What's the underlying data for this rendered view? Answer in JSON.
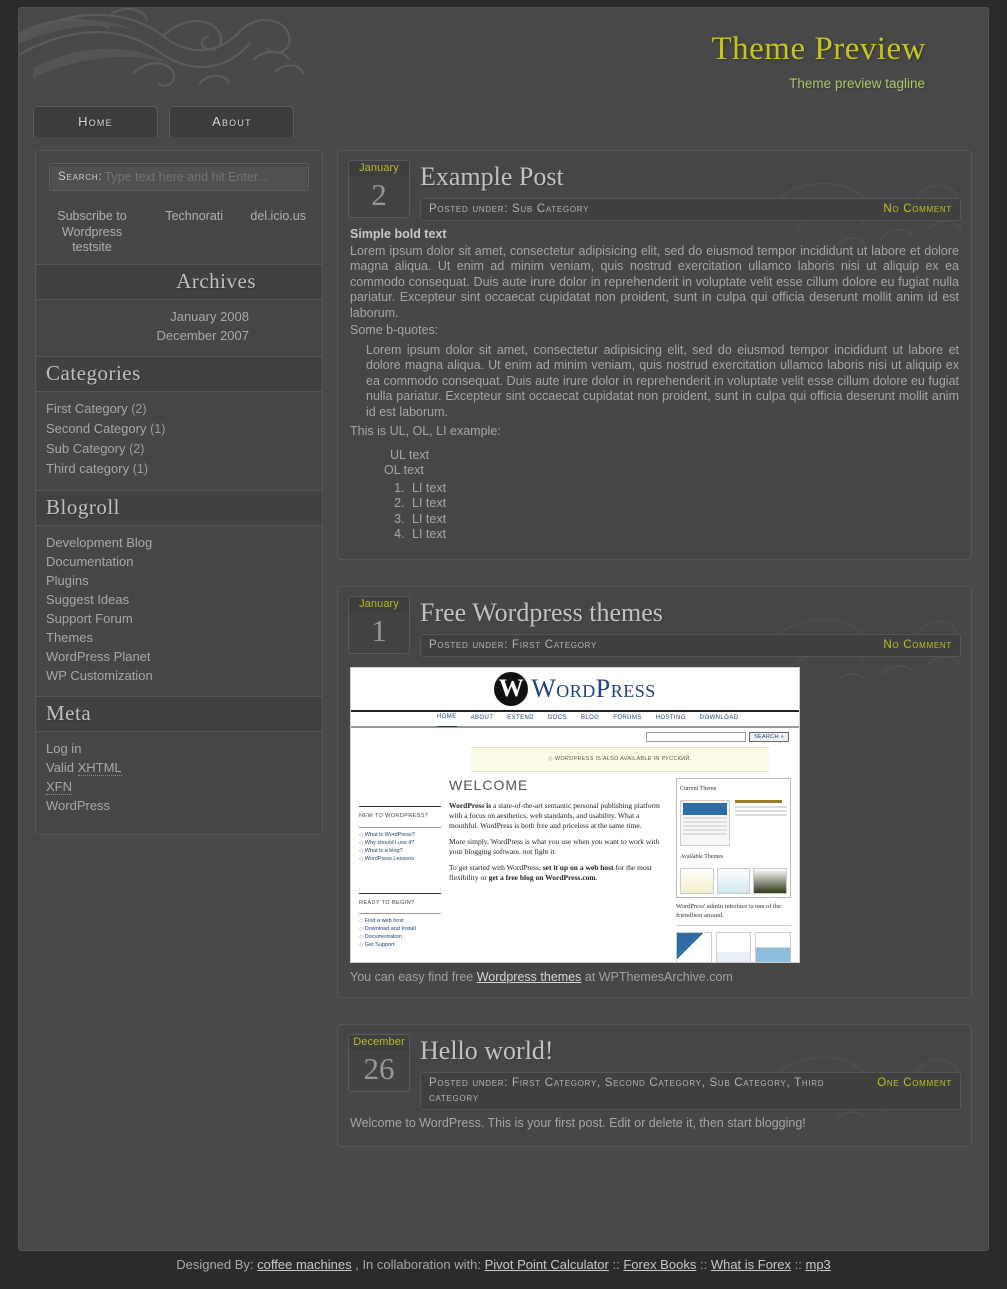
{
  "site": {
    "title": "Theme Preview",
    "tagline": "Theme preview tagline"
  },
  "nav": {
    "tabs": [
      {
        "label": "Home"
      },
      {
        "label": "About"
      }
    ]
  },
  "sidebar": {
    "search": {
      "label": "Search:",
      "placeholder": "Type text here and hit Enter...",
      "value": ""
    },
    "social": [
      {
        "label": "Subscribe to Wordpress testsite"
      },
      {
        "label": "Technorati"
      },
      {
        "label": "del.icio.us"
      }
    ],
    "archives": {
      "heading": "Archives",
      "items": [
        {
          "label": "January 2008"
        },
        {
          "label": "December 2007"
        }
      ]
    },
    "categories": {
      "heading": "Categories",
      "items": [
        {
          "label": "First Category",
          "count": "(2)"
        },
        {
          "label": "Second Category",
          "count": "(1)"
        },
        {
          "label": "Sub Category",
          "count": "(2)"
        },
        {
          "label": "Third category",
          "count": "(1)"
        }
      ]
    },
    "blogroll": {
      "heading": "Blogroll",
      "items": [
        {
          "label": "Development Blog"
        },
        {
          "label": "Documentation"
        },
        {
          "label": "Plugins"
        },
        {
          "label": "Suggest Ideas"
        },
        {
          "label": "Support Forum"
        },
        {
          "label": "Themes"
        },
        {
          "label": "WordPress Planet"
        },
        {
          "label": "WP Customization"
        }
      ]
    },
    "meta": {
      "heading": "Meta",
      "items": [
        {
          "label": "Log in"
        },
        {
          "label": "Valid ",
          "abbr": "XHTML"
        },
        {
          "label": "",
          "abbr": "XFN"
        },
        {
          "label": "WordPress"
        }
      ]
    }
  },
  "posts": {
    "post1": {
      "month": "January",
      "day": "2",
      "title": "Example Post",
      "posted_under": "Posted under: Sub Category",
      "comments": "No Comment",
      "bold_lead": "Simple bold text",
      "paragraph1": "Lorem ipsum dolor sit amet, consectetur adipisicing elit, sed do eiusmod tempor incididunt ut labore et dolore magna aliqua. Ut enim ad minim veniam, quis nostrud exercitation ullamco laboris nisi ut aliquip ex ea commodo consequat. Duis aute irure dolor in reprehenderit in voluptate velit esse cillum dolore eu fugiat nulla pariatur. Excepteur sint occaecat cupidatat non proident, sunt in culpa qui officia deserunt mollit anim id est laborum.",
      "bquote_intro": "Some b-quotes:",
      "blockquote": "Lorem ipsum dolor sit amet, consectetur adipisicing elit, sed do eiusmod tempor incididunt ut labore et dolore magna aliqua. Ut enim ad minim veniam, quis nostrud exercitation ullamco laboris nisi ut aliquip ex ea commodo consequat. Duis aute irure dolor in reprehenderit in voluptate velit esse cillum dolore eu fugiat nulla pariatur. Excepteur sint occaecat cupidatat non proident, sunt in culpa qui officia deserunt mollit anim id est laborum.",
      "list_intro": "This is UL, OL, LI example:",
      "ul_item": "UL text",
      "ol_label": "OL text",
      "ol_items": [
        {
          "label": "LI text"
        },
        {
          "label": "LI text"
        },
        {
          "label": "LI text"
        },
        {
          "label": "LI text"
        }
      ]
    },
    "post2": {
      "month": "January",
      "day": "1",
      "title": "Free Wordpress themes",
      "posted_under": "Posted under: First Category",
      "comments": "No Comment",
      "caption_before": "You can easy find free ",
      "caption_link": "Wordpress themes",
      "caption_after": " at WPThemesArchive.com"
    },
    "post3": {
      "month": "December",
      "day": "26",
      "title": "Hello world!",
      "posted_under": "Posted under: First Category, Second Category, Sub Category, Third category",
      "comments": "One Comment",
      "body": "Welcome to WordPress. This is your first post. Edit or delete it, then start blogging!"
    }
  },
  "wp_screenshot": {
    "logo_mark": "W",
    "logo_text": "WordPress",
    "nav": [
      {
        "label": "HOME"
      },
      {
        "label": "ABOUT"
      },
      {
        "label": "EXTEND"
      },
      {
        "label": "DOCS"
      },
      {
        "label": "BLOG"
      },
      {
        "label": "FORUMS"
      },
      {
        "label": "HOSTING"
      },
      {
        "label": "DOWNLOAD"
      }
    ],
    "search_button": "SEARCH »",
    "notice": "◇ WORDPRESS IS ALSO AVAILABLE IN РУССКИЙ.",
    "welcome": "WELCOME",
    "new_head": "NEW TO WORDPRESS?",
    "new_links": [
      {
        "label": "What is WordPress?"
      },
      {
        "label": "Why should I use it?"
      },
      {
        "label": "What is a blog?"
      },
      {
        "label": "WordPress Lessons"
      }
    ],
    "ready_head": "READY TO BEGIN?",
    "ready_links": [
      {
        "label": "Find a web host"
      },
      {
        "label": "Download and Install"
      },
      {
        "label": "Documentation"
      },
      {
        "label": "Get Support"
      }
    ],
    "para1_bold": "WordPress is",
    "para1": " a state-of-the-art semantic personal publishing platform with a focus on aesthetics, web standards, and usability. What a mouthful. WordPress is both free and priceless at the same time.",
    "para2": "More simply, WordPress is what you use when you want to work with your blogging software, not fight it.",
    "para3_a": "To get started with WordPress, ",
    "para3_b": "set it up on a web host",
    "para3_c": " for the most flexibility or ",
    "para3_d": "get a free blog on WordPress.com",
    "para3_e": ".",
    "current_theme_label": "Current Theme",
    "available_themes_label": "Available Themes",
    "admin_caption": "WordPress' admin interface is one of the friendliest around."
  },
  "footer": {
    "designed_by": "Designed By:",
    "link1": "coffee machines",
    "collab": ", In collaboration with:",
    "link2": "Pivot Point Calculator",
    "sep1": "::",
    "link3": "Forex Books",
    "sep2": "::",
    "link4": "What is Forex",
    "sep3": "::",
    "link5": "mp3"
  }
}
